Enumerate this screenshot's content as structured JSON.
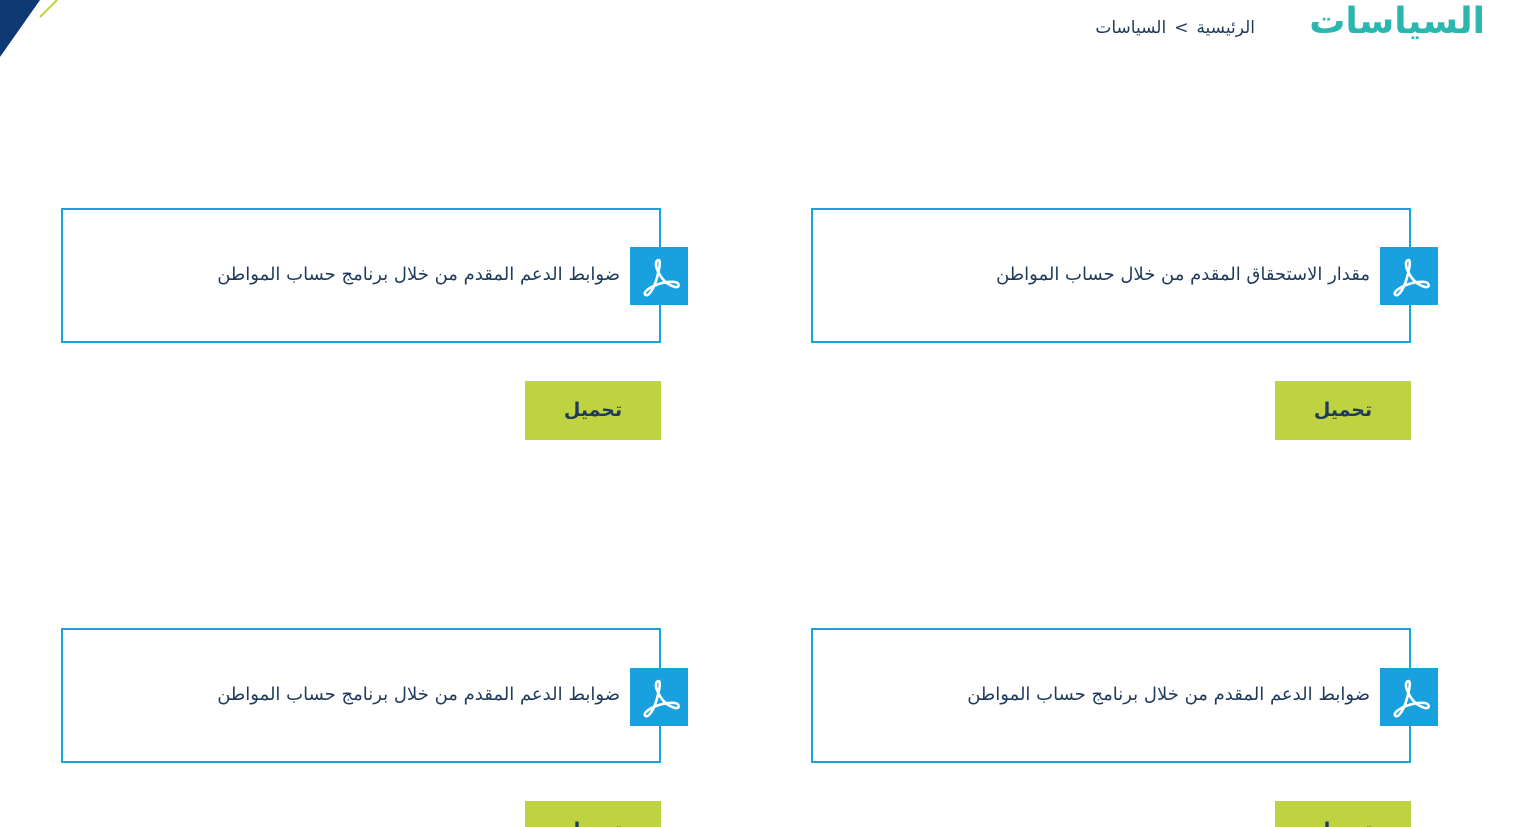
{
  "header": {
    "title": "السياسات",
    "breadcrumb": {
      "home": "الرئيسية",
      "separator": ">",
      "current": "السياسات"
    }
  },
  "colors": {
    "title": "#2bb7b0",
    "card_border": "#1aa3d9",
    "pdf_badge": "#19a0df",
    "button": "#bfd240",
    "text": "#1f3a5c",
    "corner_dark": "#0e3a73",
    "corner_accent": "#bfd240"
  },
  "policies": [
    {
      "title": "مقدار الاستحقاق المقدم من خلال حساب المواطن",
      "icon": "pdf-icon",
      "download_label": "تحميل"
    },
    {
      "title": "ضوابط الدعم المقدم من خلال برنامج حساب المواطن",
      "icon": "pdf-icon",
      "download_label": "تحميل"
    },
    {
      "title": "ضوابط الدعم المقدم من خلال برنامج حساب المواطن",
      "icon": "pdf-icon",
      "download_label": "تحميل"
    },
    {
      "title": "ضوابط الدعم المقدم من خلال برنامج حساب المواطن",
      "icon": "pdf-icon",
      "download_label": "تحميل"
    }
  ]
}
